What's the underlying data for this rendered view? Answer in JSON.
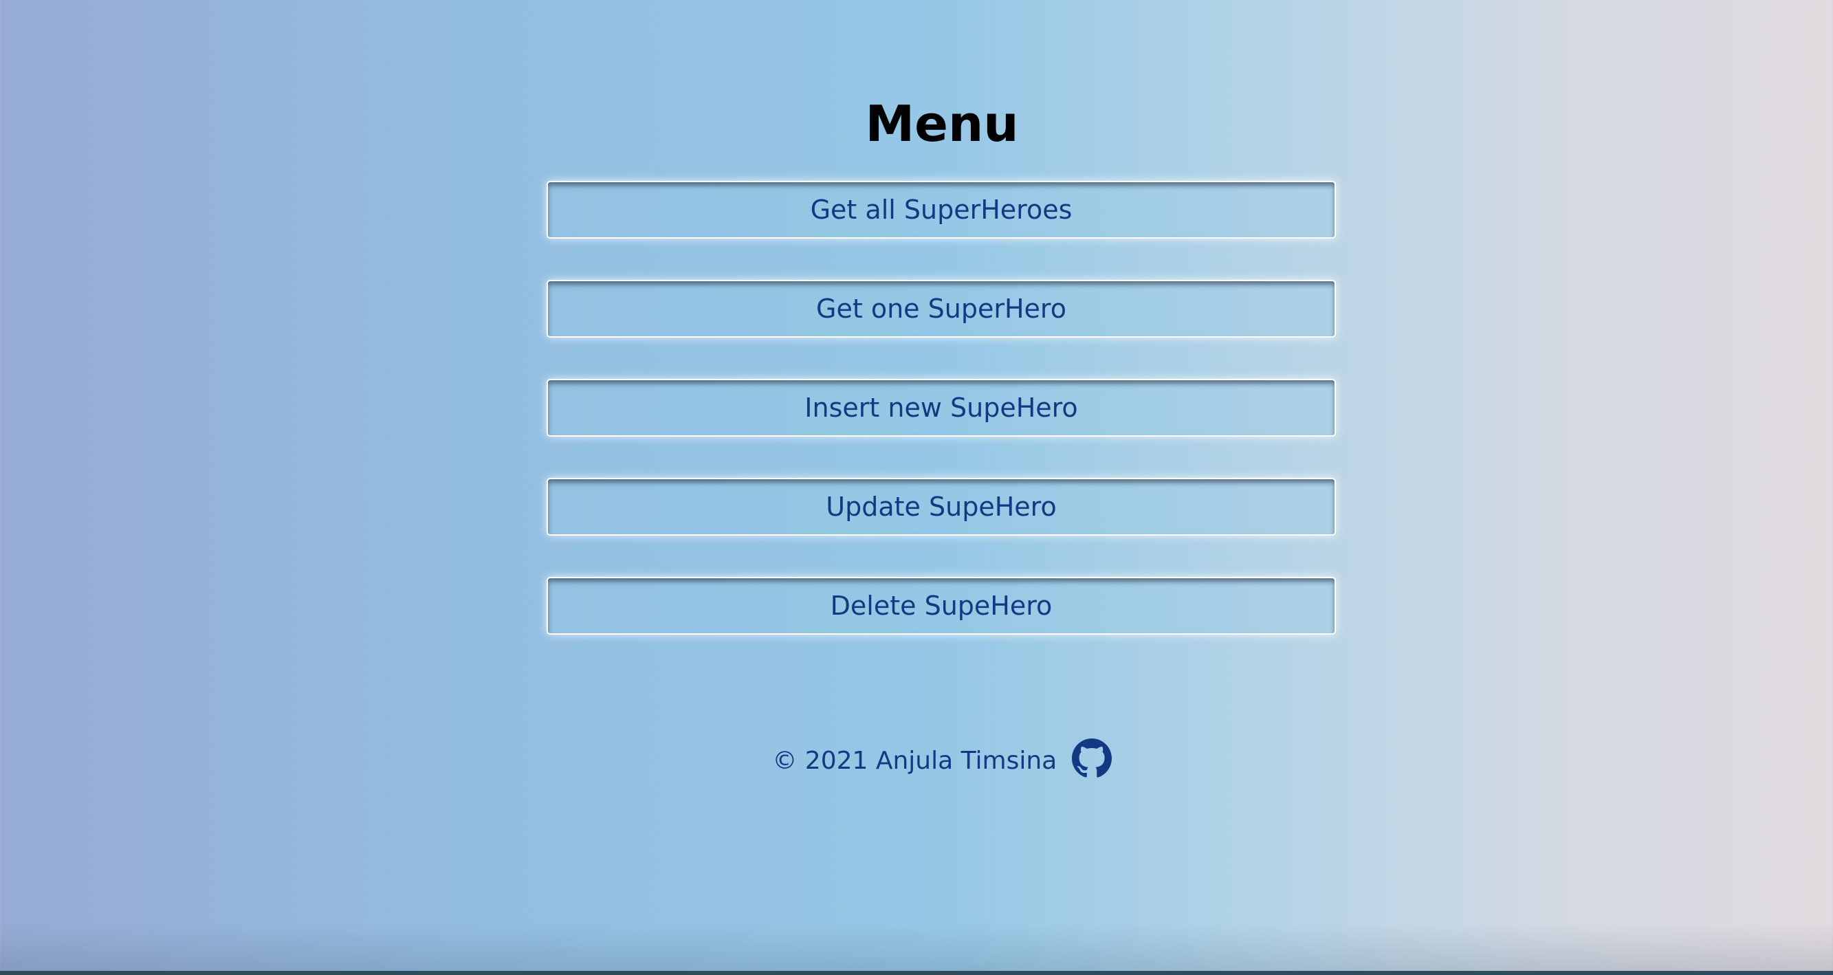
{
  "page": {
    "title": "Menu"
  },
  "menu": {
    "items": [
      {
        "label": "Get all SuperHeroes"
      },
      {
        "label": "Get one SuperHero"
      },
      {
        "label": "Insert new SupeHero"
      },
      {
        "label": "Update SupeHero"
      },
      {
        "label": "Delete SupeHero"
      }
    ]
  },
  "footer": {
    "copyright": "© 2021 Anjula Timsina",
    "icon": "github-icon"
  },
  "colors": {
    "text_accent": "#123a82",
    "button_border": "#ffffff",
    "title": "#000000"
  }
}
